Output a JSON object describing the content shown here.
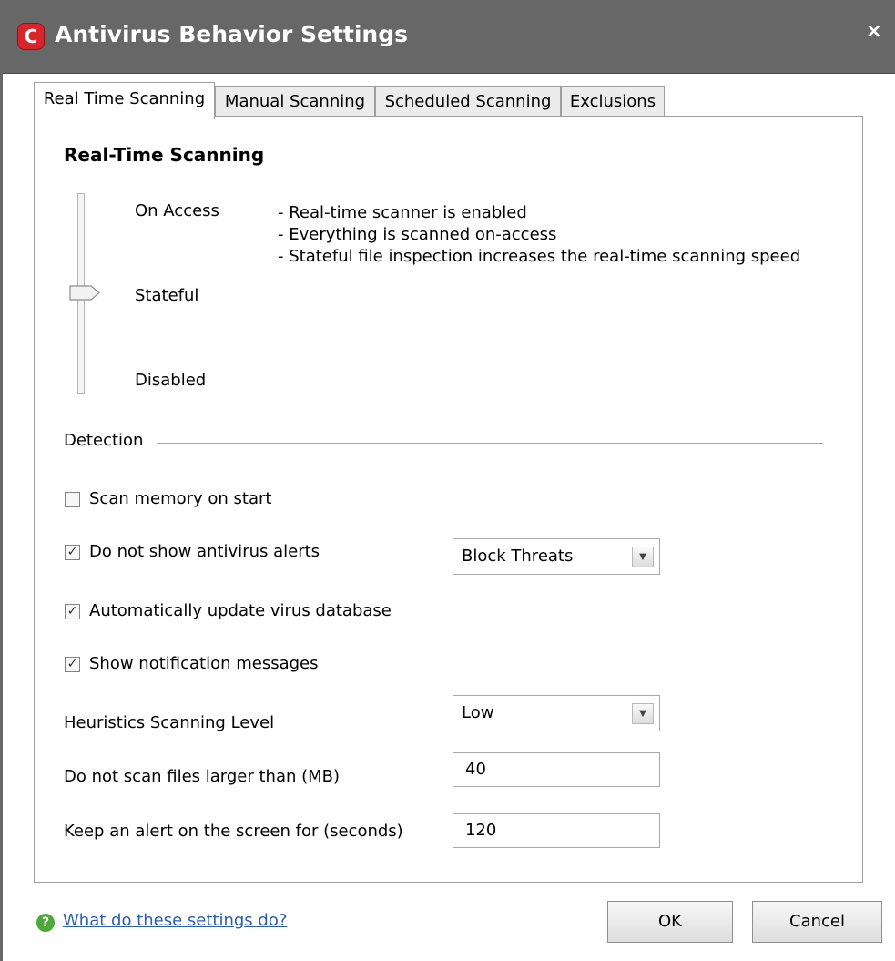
{
  "window": {
    "title": "Antivirus Behavior Settings",
    "app_icon": "C",
    "close_glyph": "×"
  },
  "tabs": [
    {
      "label": "Real Time Scanning",
      "active": true
    },
    {
      "label": "Manual Scanning",
      "active": false
    },
    {
      "label": "Scheduled Scanning",
      "active": false
    },
    {
      "label": "Exclusions",
      "active": false
    }
  ],
  "realtime": {
    "heading": "Real-Time Scanning",
    "levels": [
      "On Access",
      "Stateful",
      "Disabled"
    ],
    "selected_level": "Stateful",
    "description": [
      "- Real-time scanner is enabled",
      "- Everything is scanned on-access",
      "- Stateful file inspection increases the real-time scanning speed"
    ]
  },
  "detection": {
    "heading": "Detection",
    "scan_memory": {
      "label": "Scan memory on start",
      "checked": false
    },
    "no_alerts": {
      "label": "Do not show antivirus alerts",
      "checked": true
    },
    "alert_action": {
      "value": "Block Threats"
    },
    "auto_update": {
      "label": "Automatically update virus database",
      "checked": true
    },
    "notifications": {
      "label": "Show notification messages",
      "checked": true
    },
    "heuristics": {
      "label": "Heuristics Scanning Level",
      "value": "Low"
    },
    "max_size": {
      "label": "Do not scan files larger than (MB)",
      "value": "40"
    },
    "alert_time": {
      "label": "Keep an alert on the screen for (seconds)",
      "value": "120"
    }
  },
  "footer": {
    "help_link": "What do these settings do?",
    "ok": "OK",
    "cancel": "Cancel"
  },
  "colors": {
    "titlebar": "#676767",
    "link": "#2a5db0",
    "help_icon": "#4fa83a",
    "brand_icon": "#d8242a"
  }
}
